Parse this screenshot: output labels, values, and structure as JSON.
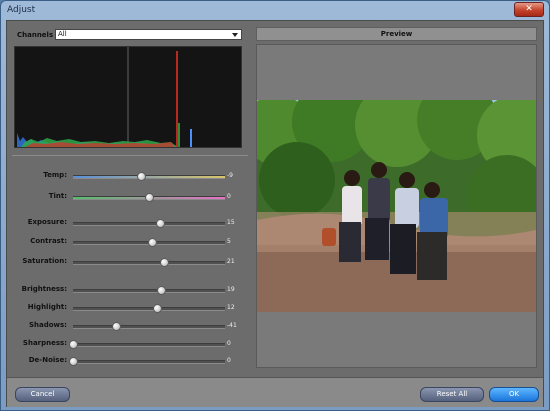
{
  "window": {
    "title": "Adjust",
    "close_glyph": "✕"
  },
  "channels": {
    "label": "Channels",
    "selected": "All"
  },
  "preview": {
    "title": "Preview"
  },
  "adjustments": [
    {
      "label": "Temp:",
      "value": "-9",
      "level": 0.45
    },
    {
      "label": "Tint:",
      "value": "0",
      "level": 0.5
    },
    {
      "label": "Exposure:",
      "value": "15",
      "level": 0.57
    },
    {
      "label": "Contrast:",
      "value": "5",
      "level": 0.52
    },
    {
      "label": "Saturation:",
      "value": "21",
      "level": 0.6
    },
    {
      "label": "Brightness:",
      "value": "19",
      "level": 0.58
    },
    {
      "label": "Highlight:",
      "value": "12",
      "level": 0.55
    },
    {
      "label": "Shadows:",
      "value": "-41",
      "level": 0.28
    },
    {
      "label": "Sharpness:",
      "value": "0",
      "level": 0.0
    },
    {
      "label": "De-Noise:",
      "value": "0",
      "level": 0.0
    }
  ],
  "buttons": {
    "cancel": "Cancel",
    "reset_all": "Reset All",
    "ok": "OK"
  },
  "colors": {
    "accent_ok": "#1a76db",
    "panel": "#6c6c6c",
    "histogram_bg": "#141414"
  }
}
